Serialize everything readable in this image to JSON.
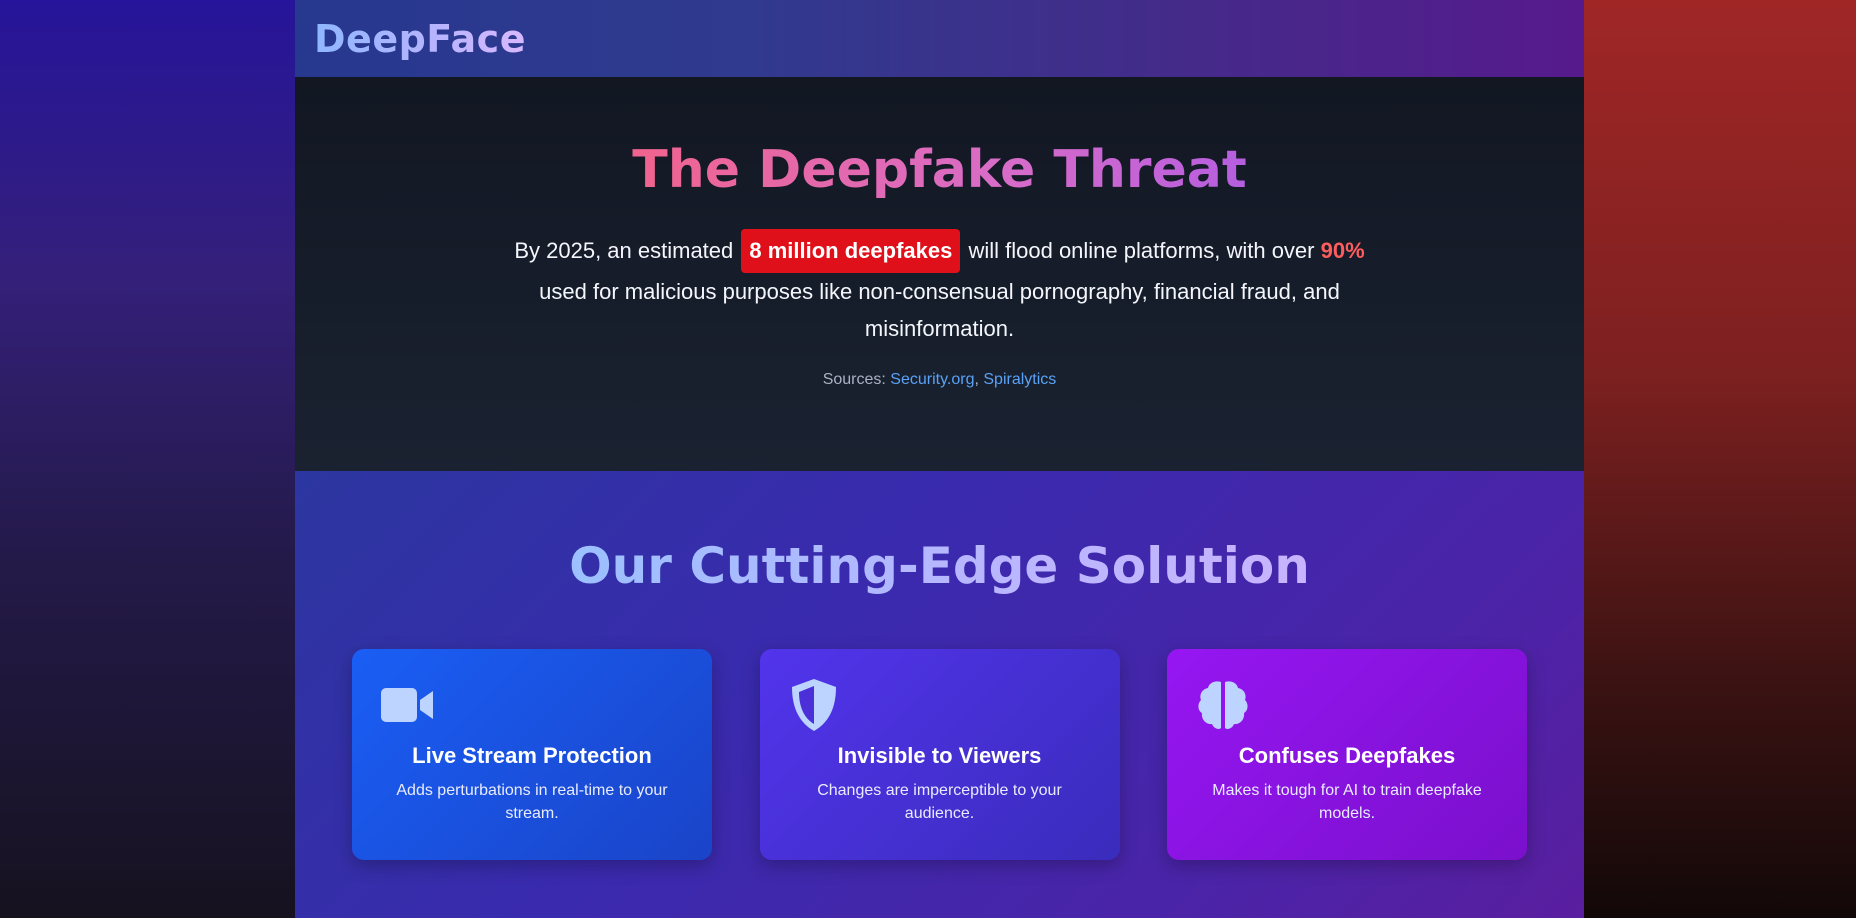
{
  "header": {
    "logo": "DeepFace"
  },
  "threat": {
    "title": "The Deepfake Threat",
    "body_before": "By 2025, an estimated ",
    "highlight": "8 million deepfakes",
    "body_middle": " will flood online platforms, with over ",
    "percent": "90%",
    "body_after": " used for malicious purposes like non-consensual pornography, financial fraud, and misinformation.",
    "sources_label": "Sources: ",
    "source_1": "Security.org",
    "source_separator": ", ",
    "source_2": "Spiralytics"
  },
  "solution": {
    "title": "Our Cutting-Edge Solution",
    "cards": [
      {
        "icon": "video-camera-icon",
        "title": "Live Stream Protection",
        "description": "Adds perturbations in real-time to your stream."
      },
      {
        "icon": "shield-icon",
        "title": "Invisible to Viewers",
        "description": "Changes are imperceptible to your audience."
      },
      {
        "icon": "brain-icon",
        "title": "Confuses Deepfakes",
        "description": "Makes it tough for AI to train deepfake models."
      }
    ]
  },
  "colors": {
    "highlight_bg": "#e0101a",
    "percent": "#ff5d5d",
    "link": "#5aa2f6",
    "icon": "#bcd4ff"
  }
}
